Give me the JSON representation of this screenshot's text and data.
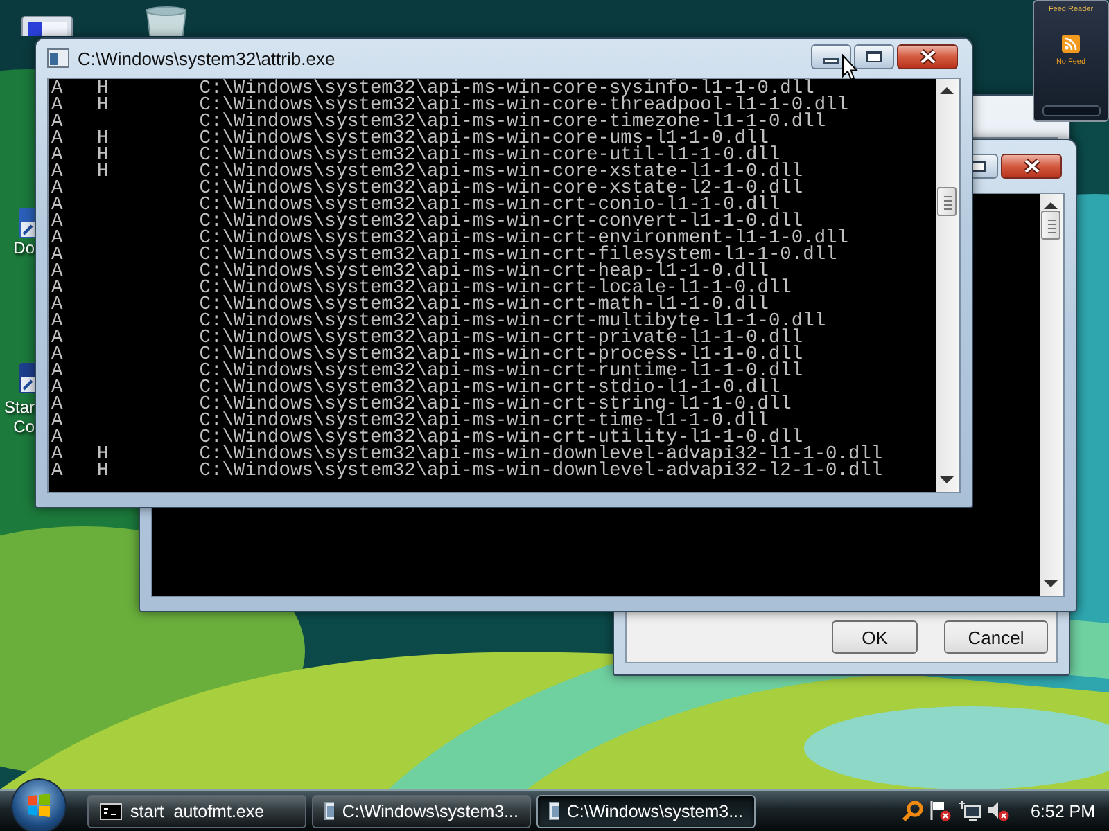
{
  "desktop": {
    "icon_labels": [
      {
        "lines": [
          "Do"
        ]
      },
      {
        "lines": [
          "Star",
          "Co"
        ]
      }
    ]
  },
  "dialog": {
    "buttons": [
      "OK",
      "Cancel"
    ]
  },
  "console_window": {
    "title": "C:\\Windows\\system32\\attrib.exe",
    "rows": [
      {
        "archive": "A",
        "hidden": "H",
        "path": "C:\\Windows\\system32\\api-ms-win-core-sysinfo-l1-1-0.dll"
      },
      {
        "archive": "A",
        "hidden": "H",
        "path": "C:\\Windows\\system32\\api-ms-win-core-threadpool-l1-1-0.dll"
      },
      {
        "archive": "A",
        "path": "C:\\Windows\\system32\\api-ms-win-core-timezone-l1-1-0.dll"
      },
      {
        "archive": "A",
        "hidden": "H",
        "path": "C:\\Windows\\system32\\api-ms-win-core-ums-l1-1-0.dll"
      },
      {
        "archive": "A",
        "hidden": "H",
        "path": "C:\\Windows\\system32\\api-ms-win-core-util-l1-1-0.dll"
      },
      {
        "archive": "A",
        "hidden": "H",
        "path": "C:\\Windows\\system32\\api-ms-win-core-xstate-l1-1-0.dll"
      },
      {
        "archive": "A",
        "path": "C:\\Windows\\system32\\api-ms-win-core-xstate-l2-1-0.dll"
      },
      {
        "archive": "A",
        "path": "C:\\Windows\\system32\\api-ms-win-crt-conio-l1-1-0.dll"
      },
      {
        "archive": "A",
        "path": "C:\\Windows\\system32\\api-ms-win-crt-convert-l1-1-0.dll"
      },
      {
        "archive": "A",
        "path": "C:\\Windows\\system32\\api-ms-win-crt-environment-l1-1-0.dll"
      },
      {
        "archive": "A",
        "path": "C:\\Windows\\system32\\api-ms-win-crt-filesystem-l1-1-0.dll"
      },
      {
        "archive": "A",
        "path": "C:\\Windows\\system32\\api-ms-win-crt-heap-l1-1-0.dll"
      },
      {
        "archive": "A",
        "path": "C:\\Windows\\system32\\api-ms-win-crt-locale-l1-1-0.dll"
      },
      {
        "archive": "A",
        "path": "C:\\Windows\\system32\\api-ms-win-crt-math-l1-1-0.dll"
      },
      {
        "archive": "A",
        "path": "C:\\Windows\\system32\\api-ms-win-crt-multibyte-l1-1-0.dll"
      },
      {
        "archive": "A",
        "path": "C:\\Windows\\system32\\api-ms-win-crt-private-l1-1-0.dll"
      },
      {
        "archive": "A",
        "path": "C:\\Windows\\system32\\api-ms-win-crt-process-l1-1-0.dll"
      },
      {
        "archive": "A",
        "path": "C:\\Windows\\system32\\api-ms-win-crt-runtime-l1-1-0.dll"
      },
      {
        "archive": "A",
        "path": "C:\\Windows\\system32\\api-ms-win-crt-stdio-l1-1-0.dll"
      },
      {
        "archive": "A",
        "path": "C:\\Windows\\system32\\api-ms-win-crt-string-l1-1-0.dll"
      },
      {
        "archive": "A",
        "path": "C:\\Windows\\system32\\api-ms-win-crt-time-l1-1-0.dll"
      },
      {
        "archive": "A",
        "path": "C:\\Windows\\system32\\api-ms-win-crt-utility-l1-1-0.dll"
      },
      {
        "archive": "A",
        "hidden": "H",
        "path": "C:\\Windows\\system32\\api-ms-win-downlevel-advapi32-l1-1-0.dll"
      },
      {
        "archive": "A",
        "hidden": "H",
        "path": "C:\\Windows\\system32\\api-ms-win-downlevel-advapi32-l2-1-0.dll"
      }
    ]
  },
  "gadget": {
    "title": "Feed Reader",
    "message": "No Feed"
  },
  "taskbar": {
    "buttons": [
      {
        "kind": "console",
        "label": "start  autofmt.exe",
        "selected": false
      },
      {
        "kind": "window",
        "label": "C:\\Windows\\system3...",
        "selected": false
      },
      {
        "kind": "window",
        "label": "C:\\Windows\\system3...",
        "selected": true
      }
    ],
    "clock": "6:52 PM"
  }
}
